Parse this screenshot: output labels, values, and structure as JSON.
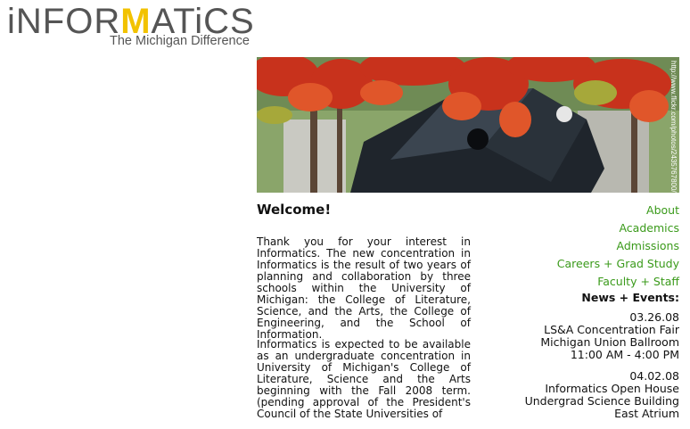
{
  "logo": {
    "word_pre": "iNFOR",
    "word_m": "M",
    "word_post": "ATiCS",
    "tagline": "The Michigan Difference"
  },
  "hero": {
    "credit": "http://www.flickr.com/photos/2435767800/"
  },
  "main": {
    "title": "Welcome!",
    "paragraphs": [
      "Thank you for your interest in Informatics. The new concentration in Informatics is the result of two years of planning and collaboration by three schools within the University of Michigan: the College of Literature, Science, and the Arts, the College of Engineering, and the School of Information.",
      "Informatics is expected to be available as an undergraduate concentration in University of Michigan's College of Literature, Science and the Arts beginning with the Fall 2008 term. (pending approval of the President's Council of the State Universities of"
    ]
  },
  "nav": {
    "items": [
      {
        "label": "About"
      },
      {
        "label": "Academics"
      },
      {
        "label": "Admissions"
      },
      {
        "label": "Careers + Grad Study"
      },
      {
        "label": "Faculty + Staff"
      }
    ]
  },
  "events": {
    "heading": "News + Events:",
    "items": [
      {
        "date": "03.26.08",
        "title": "LS&A Concentration Fair",
        "location": "Michigan Union Ballroom",
        "time": "11:00 AM - 4:00 PM"
      },
      {
        "date": "04.02.08",
        "title": "Informatics Open House",
        "location": "Undergrad Science Building",
        "time": "East Atrium"
      }
    ]
  },
  "colors": {
    "link_green": "#3a9a1a",
    "logo_gray": "#555555",
    "logo_maize": "#f2c200"
  }
}
